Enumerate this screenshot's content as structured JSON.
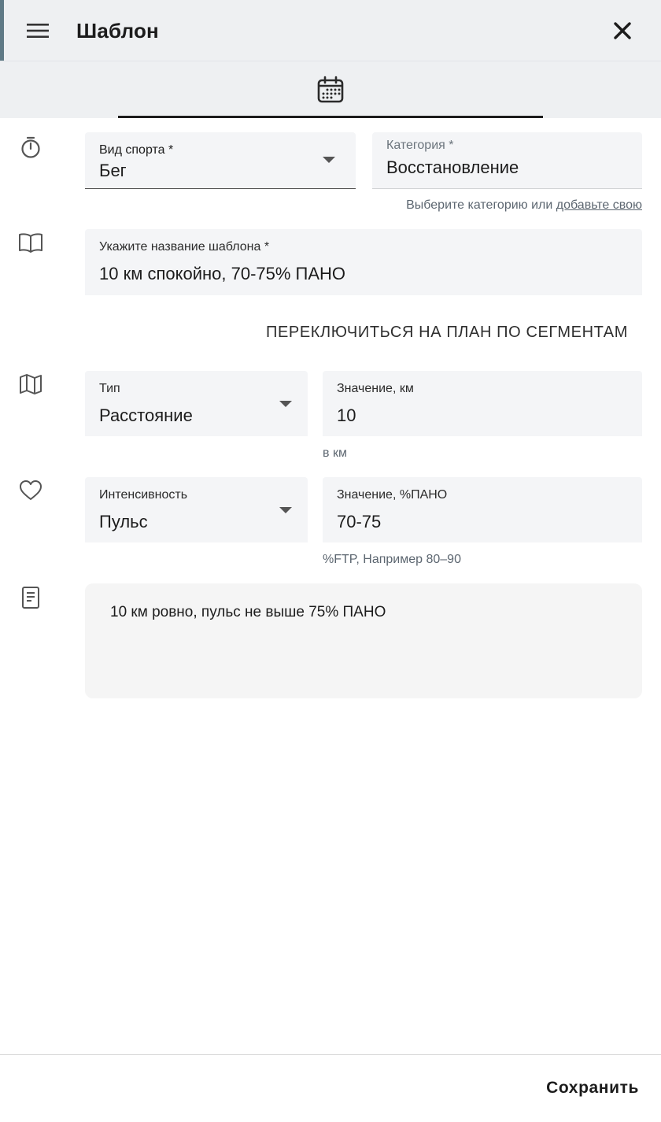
{
  "header": {
    "title": "Шаблон"
  },
  "icons": {
    "menu": "menu-icon",
    "close": "close-icon",
    "calendar": "calendar-icon",
    "timer": "timer-icon",
    "book": "book-icon",
    "map": "map-icon",
    "heart": "heart-icon",
    "note": "note-icon"
  },
  "sport": {
    "label": "Вид спорта *",
    "value": "Бег"
  },
  "category": {
    "label": "Категория *",
    "value": "Восстановление",
    "helper_prefix": "Выберите категорию или",
    "helper_link": "добавьте свою"
  },
  "name": {
    "label": "Укажите название шаблона *",
    "value": "10 км спокойно, 70-75% ПАНО"
  },
  "segment_switch": "ПЕРЕКЛЮЧИТЬСЯ НА ПЛАН ПО СЕГМЕНТАМ",
  "type": {
    "label": "Тип",
    "value": "Расстояние"
  },
  "distance": {
    "label": "Значение, км",
    "value": "10",
    "helper": "в км"
  },
  "intensity": {
    "label": "Интенсивность",
    "value": "Пульс"
  },
  "intensity_value": {
    "label": "Значение, %ПАНО",
    "value": "70-75",
    "helper": "%FTP, Например 80–90"
  },
  "notes": {
    "value": "10 км ровно, пульс не выше 75% ПАНО"
  },
  "footer": {
    "save_label": "Сохранить"
  },
  "colors": {
    "accent": "#1c1c1c",
    "field_bg": "#f4f5f7",
    "header_bg": "#eef0f2",
    "left_strip": "#5f7a86"
  }
}
